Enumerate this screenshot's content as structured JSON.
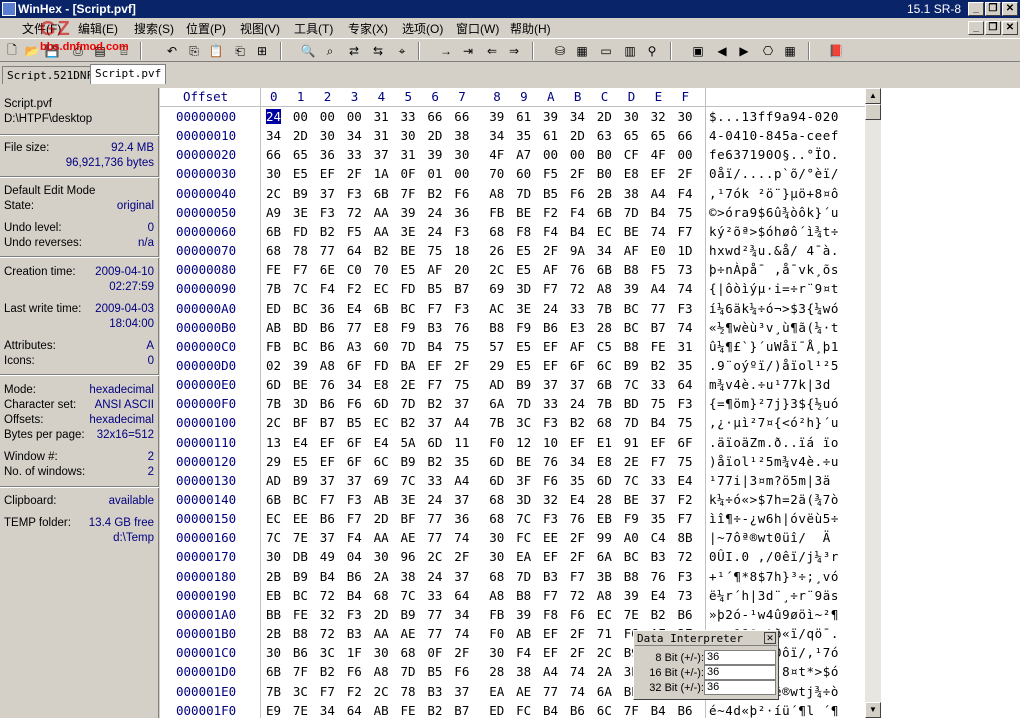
{
  "window": {
    "title": "WinHex - [Script.pvf]",
    "version": "15.1 SR-8"
  },
  "menu": [
    "文件(F)",
    "编辑(E)",
    "搜索(S)",
    "位置(P)",
    "视图(V)",
    "工具(T)",
    "专家(X)",
    "选项(O)",
    "窗口(W)",
    "帮助(H)"
  ],
  "tabs": [
    "Script.521DNF",
    "Script.pvf"
  ],
  "watermark": {
    "site": "bbs.dnfmod.com"
  },
  "info": {
    "filename": "Script.pvf",
    "path": "D:\\HTPF\\desktop",
    "file_size_label": "File size:",
    "file_size_mb": "92.4 MB",
    "file_size_bytes": "96,921,736 bytes",
    "edit_mode_label": "Default Edit Mode",
    "state_label": "State:",
    "state": "original",
    "undo_level_label": "Undo level:",
    "undo_level": "0",
    "undo_reverses_label": "Undo reverses:",
    "undo_reverses": "n/a",
    "creation_label": "Creation time:",
    "creation_date": "2009-04-10",
    "creation_time": "02:27:59",
    "lastwrite_label": "Last write time:",
    "lastwrite_date": "2009-04-03",
    "lastwrite_time": "18:04:00",
    "attributes_label": "Attributes:",
    "attributes": "A",
    "icons_label": "Icons:",
    "icons": "0",
    "mode_label": "Mode:",
    "mode": "hexadecimal",
    "charset_label": "Character set:",
    "charset": "ANSI ASCII",
    "offsets_label": "Offsets:",
    "offsets": "hexadecimal",
    "bpp_label": "Bytes per page:",
    "bpp": "32x16=512",
    "window_label": "Window #:",
    "window_no": "2",
    "windows_label": "No. of windows:",
    "windows": "2",
    "clipboard_label": "Clipboard:",
    "clipboard": "available",
    "temp_label": "TEMP folder:",
    "temp_free": "13.4 GB free",
    "temp_path": "d:\\Temp"
  },
  "hex": {
    "offset_header": "Offset",
    "columns": [
      "0",
      "1",
      "2",
      "3",
      "4",
      "5",
      "6",
      "7",
      "8",
      "9",
      "A",
      "B",
      "C",
      "D",
      "E",
      "F"
    ],
    "rows": [
      {
        "off": "00000000",
        "b": [
          "24",
          "00",
          "00",
          "00",
          "31",
          "33",
          "66",
          "66",
          "39",
          "61",
          "39",
          "34",
          "2D",
          "30",
          "32",
          "30"
        ],
        "a": "$...13ff9a94-020"
      },
      {
        "off": "00000010",
        "b": [
          "34",
          "2D",
          "30",
          "34",
          "31",
          "30",
          "2D",
          "38",
          "34",
          "35",
          "61",
          "2D",
          "63",
          "65",
          "65",
          "66"
        ],
        "a": "4-0410-845a-ceef"
      },
      {
        "off": "00000020",
        "b": [
          "66",
          "65",
          "36",
          "33",
          "37",
          "31",
          "39",
          "30",
          "4F",
          "A7",
          "00",
          "00",
          "B0",
          "CF",
          "4F",
          "00"
        ],
        "a": "fe637190O§..°ÏO."
      },
      {
        "off": "00000030",
        "b": [
          "30",
          "E5",
          "EF",
          "2F",
          "1A",
          "0F",
          "01",
          "00",
          "70",
          "60",
          "F5",
          "2F",
          "B0",
          "E8",
          "EF",
          "2F"
        ],
        "a": "0åï/....p`õ/°èï/"
      },
      {
        "off": "00000040",
        "b": [
          "2C",
          "B9",
          "37",
          "F3",
          "6B",
          "7F",
          "B2",
          "F6",
          "A8",
          "7D",
          "B5",
          "F6",
          "2B",
          "38",
          "A4",
          "F4"
        ],
        "a": ",¹7ók ²ö¨}µö+8¤ô"
      },
      {
        "off": "00000050",
        "b": [
          "A9",
          "3E",
          "F3",
          "72",
          "AA",
          "39",
          "24",
          "36",
          "FB",
          "BE",
          "F2",
          "F4",
          "6B",
          "7D",
          "B4",
          "75"
        ],
        "a": "©>óra9$6û¾òôk}´u"
      },
      {
        "off": "00000060",
        "b": [
          "6B",
          "FD",
          "B2",
          "F5",
          "AA",
          "3E",
          "24",
          "F3",
          "68",
          "F8",
          "F4",
          "B4",
          "EC",
          "BE",
          "74",
          "F7"
        ],
        "a": "ký²õª>$óhøô´ì¾t÷"
      },
      {
        "off": "00000070",
        "b": [
          "68",
          "78",
          "77",
          "64",
          "B2",
          "BE",
          "75",
          "18",
          "26",
          "E5",
          "2F",
          "9A",
          "34",
          "AF",
          "E0",
          "1D"
        ],
        "a": "hxwd²¾u.&å/ 4¯à."
      },
      {
        "off": "00000080",
        "b": [
          "FE",
          "F7",
          "6E",
          "C0",
          "70",
          "E5",
          "AF",
          "20",
          "2C",
          "E5",
          "AF",
          "76",
          "6B",
          "B8",
          "F5",
          "73"
        ],
        "a": "þ÷nÀpå¯ ,å¯vk¸õs"
      },
      {
        "off": "00000090",
        "b": [
          "7B",
          "7C",
          "F4",
          "F2",
          "EC",
          "FD",
          "B5",
          "B7",
          "69",
          "3D",
          "F7",
          "72",
          "A8",
          "39",
          "A4",
          "74"
        ],
        "a": "{|ôòìýµ·i=÷r¨9¤t"
      },
      {
        "off": "000000A0",
        "b": [
          "ED",
          "BC",
          "36",
          "E4",
          "6B",
          "BC",
          "F7",
          "F3",
          "AC",
          "3E",
          "24",
          "33",
          "7B",
          "BC",
          "77",
          "F3"
        ],
        "a": "í¼6äk¼÷ó¬>$3{¼wó"
      },
      {
        "off": "000000B0",
        "b": [
          "AB",
          "BD",
          "B6",
          "77",
          "E8",
          "F9",
          "B3",
          "76",
          "B8",
          "F9",
          "B6",
          "E3",
          "28",
          "BC",
          "B7",
          "74"
        ],
        "a": "«½¶wèù³v¸ù¶ã(¼·t"
      },
      {
        "off": "000000C0",
        "b": [
          "FB",
          "BC",
          "B6",
          "A3",
          "60",
          "7D",
          "B4",
          "75",
          "57",
          "E5",
          "EF",
          "AF",
          "C5",
          "B8",
          "FE",
          "31"
        ],
        "a": "û¼¶£`}´uWåï¯Å¸þ1"
      },
      {
        "off": "000000D0",
        "b": [
          "02",
          "39",
          "A8",
          "6F",
          "FD",
          "BA",
          "EF",
          "2F",
          "29",
          "E5",
          "EF",
          "6F",
          "6C",
          "B9",
          "B2",
          "35"
        ],
        "a": ".9¨oýºï/)åïol¹²5"
      },
      {
        "off": "000000E0",
        "b": [
          "6D",
          "BE",
          "76",
          "34",
          "E8",
          "2E",
          "F7",
          "75",
          "AD",
          "B9",
          "37",
          "37",
          "6B",
          "7C",
          "33",
          "64"
        ],
        "a": "m¾v4è.÷u­¹77k|3d"
      },
      {
        "off": "000000F0",
        "b": [
          "7B",
          "3D",
          "B6",
          "F6",
          "6D",
          "7D",
          "B2",
          "37",
          "6A",
          "7D",
          "33",
          "24",
          "7B",
          "BD",
          "75",
          "F3"
        ],
        "a": "{=¶öm}²7j}3${½uó"
      },
      {
        "off": "00000100",
        "b": [
          "2C",
          "BF",
          "B7",
          "B5",
          "EC",
          "B2",
          "37",
          "A4",
          "7B",
          "3C",
          "F3",
          "B2",
          "68",
          "7D",
          "B4",
          "75"
        ],
        "a": ",¿·µì²7¤{<ó²h}´u"
      },
      {
        "off": "00000110",
        "b": [
          "13",
          "E4",
          "EF",
          "6F",
          "E4",
          "5A",
          "6D",
          "11",
          "F0",
          "12",
          "10",
          "EF",
          "E1",
          "91",
          "EF",
          "6F"
        ],
        "a": ".äïoäZm.ð..ïá ïo"
      },
      {
        "off": "00000120",
        "b": [
          "29",
          "E5",
          "EF",
          "6F",
          "6C",
          "B9",
          "B2",
          "35",
          "6D",
          "BE",
          "76",
          "34",
          "E8",
          "2E",
          "F7",
          "75"
        ],
        "a": ")åïol¹²5m¾v4è.÷u"
      },
      {
        "off": "00000130",
        "b": [
          "AD",
          "B9",
          "37",
          "37",
          "69",
          "7C",
          "33",
          "A4",
          "6D",
          "3F",
          "F6",
          "35",
          "6D",
          "7C",
          "33",
          "E4"
        ],
        "a": "­¹77i|3¤m?ö5m|3ä"
      },
      {
        "off": "00000140",
        "b": [
          "6B",
          "BC",
          "F7",
          "F3",
          "AB",
          "3E",
          "24",
          "37",
          "68",
          "3D",
          "32",
          "E4",
          "28",
          "BE",
          "37",
          "F2"
        ],
        "a": "k¼÷ó«>$7h=2ä(¾7ò"
      },
      {
        "off": "00000150",
        "b": [
          "EC",
          "EE",
          "B6",
          "F7",
          "2D",
          "BF",
          "77",
          "36",
          "68",
          "7C",
          "F3",
          "76",
          "EB",
          "F9",
          "35",
          "F7"
        ],
        "a": "ìî¶÷-¿w6h|óvëù5÷"
      },
      {
        "off": "00000160",
        "b": [
          "7C",
          "7E",
          "37",
          "F4",
          "AA",
          "AE",
          "77",
          "74",
          "30",
          "FC",
          "EE",
          "2F",
          "99",
          "A0",
          "C4",
          "8B"
        ],
        "a": "|~7ôª®wt0üî/  Ä "
      },
      {
        "off": "00000170",
        "b": [
          "30",
          "DB",
          "49",
          "04",
          "30",
          "96",
          "2C",
          "2F",
          "30",
          "EA",
          "EF",
          "2F",
          "6A",
          "BC",
          "B3",
          "72"
        ],
        "a": "0ÛI.0 ,/0êï/j¼³r"
      },
      {
        "off": "00000180",
        "b": [
          "2B",
          "B9",
          "B4",
          "B6",
          "2A",
          "38",
          "24",
          "37",
          "68",
          "7D",
          "B3",
          "F7",
          "3B",
          "B8",
          "76",
          "F3"
        ],
        "a": "+¹´¶*8$7h}³÷;¸vó"
      },
      {
        "off": "00000190",
        "b": [
          "EB",
          "BC",
          "72",
          "B4",
          "68",
          "7C",
          "33",
          "64",
          "A8",
          "B8",
          "F7",
          "72",
          "A8",
          "39",
          "E4",
          "73"
        ],
        "a": "ë¼r´h|3d¨¸÷r¨9äs"
      },
      {
        "off": "000001A0",
        "b": [
          "BB",
          "FE",
          "32",
          "F3",
          "2D",
          "B9",
          "77",
          "34",
          "FB",
          "39",
          "F8",
          "F6",
          "EC",
          "7E",
          "B2",
          "B6"
        ],
        "a": "»þ2ó-¹w4û9øöì~²¶"
      },
      {
        "off": "000001B0",
        "b": [
          "2B",
          "B8",
          "72",
          "B3",
          "AA",
          "AE",
          "77",
          "74",
          "F0",
          "AB",
          "EF",
          "2F",
          "71",
          "F6",
          "AF",
          "2E"
        ],
        "a": "+¸r³ª®wtð«ï/qö¯."
      },
      {
        "off": "000001C0",
        "b": [
          "30",
          "B6",
          "3C",
          "1F",
          "30",
          "68",
          "0F",
          "2F",
          "30",
          "F4",
          "EF",
          "2F",
          "2C",
          "B9",
          "37",
          "F3"
        ],
        "a": "0¶<.0h./0ôï/,¹7ó"
      },
      {
        "off": "000001D0",
        "b": [
          "6B",
          "7F",
          "B2",
          "F6",
          "A8",
          "7D",
          "B5",
          "F6",
          "28",
          "38",
          "A4",
          "74",
          "2A",
          "3E",
          "24",
          "F3"
        ],
        "a": "k ²ö¨}µö(8¤t*>$ó"
      },
      {
        "off": "000001E0",
        "b": [
          "7B",
          "3C",
          "F7",
          "F2",
          "2C",
          "78",
          "B3",
          "37",
          "EA",
          "AE",
          "77",
          "74",
          "6A",
          "BE",
          "F7",
          "F2"
        ],
        "a": "{<÷ò,x³7ê®wtj¾÷ò"
      },
      {
        "off": "000001F0",
        "b": [
          "E9",
          "7E",
          "34",
          "64",
          "AB",
          "FE",
          "B2",
          "B7",
          "ED",
          "FC",
          "B4",
          "B6",
          "6C",
          "7F",
          "B4",
          "B6"
        ],
        "a": "é~4d«þ²·íü´¶l ´¶"
      }
    ]
  },
  "interpreter": {
    "title": "Data Interpreter",
    "rows": [
      {
        "label": "8 Bit (+/-):",
        "value": "36"
      },
      {
        "label": "16 Bit (+/-):",
        "value": "36"
      },
      {
        "label": "32 Bit (+/-):",
        "value": "36"
      }
    ]
  }
}
